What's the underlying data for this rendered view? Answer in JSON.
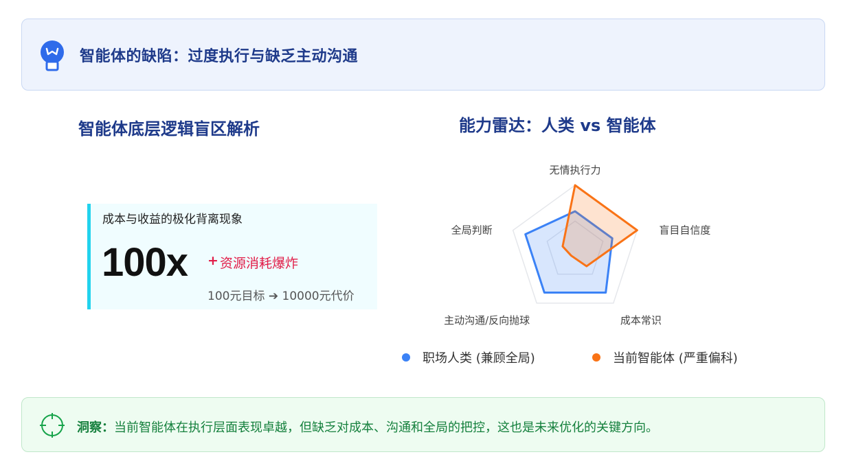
{
  "banner": {
    "icon": "lightbulb-icon",
    "title": "智能体的缺陷：过度执行与缺乏主动沟通"
  },
  "left": {
    "heading": "智能体底层逻辑盲区解析",
    "card": {
      "label": "成本与收益的极化背离现象",
      "value": "100x",
      "plus": "+",
      "highlight": "资源消耗爆炸",
      "sub": "100元目标 ➔ 10000元代价"
    }
  },
  "right": {
    "heading": "能力雷达：人类 vs 智能体"
  },
  "chart_data": {
    "type": "radar",
    "axes": [
      "无情执行力",
      "盲目自信度",
      "成本常识",
      "主动沟通/反向抛球",
      "全局判断"
    ],
    "range": [
      0,
      10
    ],
    "grid": true,
    "legend_position": "bottom",
    "series": [
      {
        "name": "职场人类 (兼顾全局)",
        "color": "#3b82f6",
        "values": [
          6,
          6,
          8,
          8,
          8
        ]
      },
      {
        "name": "当前智能体 (严重偏科)",
        "color": "#f97316",
        "values": [
          10,
          10,
          3,
          1,
          2
        ]
      }
    ]
  },
  "legend": {
    "human": {
      "label": "职场人类 (兼顾全局)",
      "color": "#3b82f6"
    },
    "agent": {
      "label": "当前智能体 (严重偏科)",
      "color": "#f97316"
    }
  },
  "insight": {
    "icon": "crosshair-icon",
    "prefix": "洞察：",
    "text": "当前智能体在执行层面表现卓越，但缺乏对成本、沟通和全局的把控，这也是未来优化的关键方向。"
  }
}
